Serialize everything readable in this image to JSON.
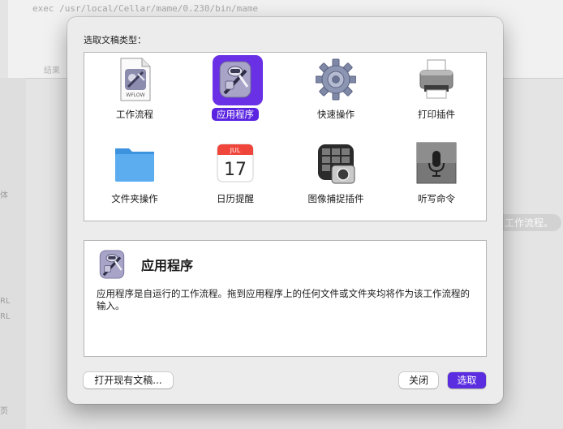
{
  "background": {
    "code_line": "exec /usr/local/Cellar/mame/0.230/bin/mame",
    "tab_label": "结果",
    "sidebar_texts": [
      "体",
      "RL",
      "RL",
      "页"
    ],
    "right_hint": "工作流程。"
  },
  "dialog": {
    "title": "选取文稿类型：",
    "types": [
      {
        "label": "工作流程",
        "icon": "workflow-file-icon",
        "selected": false
      },
      {
        "label": "应用程序",
        "icon": "automator-robot-icon",
        "selected": true
      },
      {
        "label": "快速操作",
        "icon": "gear-icon",
        "selected": false
      },
      {
        "label": "打印插件",
        "icon": "printer-icon",
        "selected": false
      },
      {
        "label": "文件夹操作",
        "icon": "folder-icon",
        "selected": false
      },
      {
        "label": "日历提醒",
        "icon": "calendar-icon",
        "selected": false
      },
      {
        "label": "图像捕捉插件",
        "icon": "image-capture-icon",
        "selected": false
      },
      {
        "label": "听写命令",
        "icon": "microphone-icon",
        "selected": false
      }
    ],
    "calendar_icon": {
      "month": "JUL",
      "day": "17"
    },
    "workflow_icon_text": "WFLOW",
    "description": {
      "title": "应用程序",
      "text": "应用程序是自运行的工作流程。拖到应用程序上的任何文件或文件夹均将作为该工作流程的输入。"
    },
    "buttons": {
      "open_existing": "打开现有文稿...",
      "close": "关闭",
      "choose": "选取"
    }
  },
  "colors": {
    "accent": "#5b2de0",
    "panel_border": "#b5b5b5",
    "dialog_bg": "#ececec"
  }
}
